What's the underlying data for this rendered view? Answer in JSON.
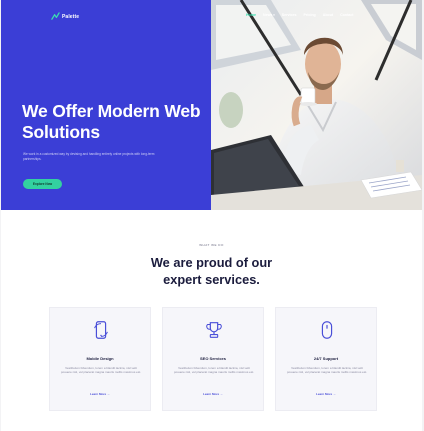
{
  "brand": {
    "name": "Palette"
  },
  "nav": {
    "items": [
      {
        "label": "Home",
        "active": true,
        "dropdown": false
      },
      {
        "label": "News",
        "active": false,
        "dropdown": true
      },
      {
        "label": "Services",
        "active": false,
        "dropdown": false
      },
      {
        "label": "Pricing",
        "active": false,
        "dropdown": false
      },
      {
        "label": "About",
        "active": false,
        "dropdown": false
      },
      {
        "label": "Contact",
        "active": false,
        "dropdown": false
      }
    ]
  },
  "hero": {
    "title": "We Offer Modern Web Solutions",
    "description": "We work in a customized way by devising and handling entirely online projects with long-term partnerships.",
    "cta_label": "Explore Now"
  },
  "services_section": {
    "eyebrow": "WHAT WE DO",
    "title": "We are proud of our expert services.",
    "cards": [
      {
        "icon": "mobile-refresh-icon",
        "title": "Mobile Design",
        "text": "Vestibulum bibendum, lorem a blandit lacinia, nisl velit posuere nisl, vel placerat magna mauris mollis maximus est.",
        "link": "Learn More →"
      },
      {
        "icon": "trophy-icon",
        "title": "SEO Services",
        "text": "Vestibulum bibendum, lorem a blandit lacinia, nisl velit posuere nisl, vel placerat magna mauris mollis maximus est.",
        "link": "Learn More →"
      },
      {
        "icon": "mouse-icon",
        "title": "24/7 Support",
        "text": "Vestibulum bibendum, lorem a blandit lacinia, nisl velit posuere nisl, vel placerat magna mauris mollis maximus est.",
        "link": "Learn More →"
      }
    ]
  },
  "colors": {
    "primary": "#3b3ed6",
    "accent": "#33d1a0",
    "heading": "#1b1c3d"
  }
}
